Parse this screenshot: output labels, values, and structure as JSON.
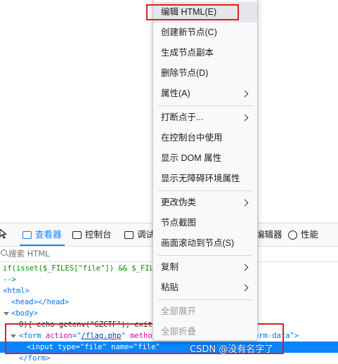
{
  "devtools": {
    "tabs": [
      {
        "label": "查看器",
        "selected": true
      },
      {
        "label": "控制台",
        "selected": false
      },
      {
        "label": "调试",
        "selected": false
      },
      {
        "label": "编辑器",
        "selected": false
      },
      {
        "label": "性能",
        "selected": false
      }
    ],
    "search_placeholder": "搜索 HTML",
    "code": {
      "php_line": "if(isset($_FILES[\"file\"]) && $_FILES",
      "comment_end": "-->",
      "html_open": "<html>",
      "head": "<head></head>",
      "body_open": "<body>",
      "text_echo": "0){ echo getenv(\"GZCTF",
      "text_echo_tail": "\"); exit;",
      "form_open": "<form",
      "form_action_attr": "action",
      "form_action_val": "/flag.php",
      "form_method_attr": "method",
      "form_tail": "c/form-data\">",
      "input_tag": "<input",
      "input_type_attr": "type",
      "input_type_val": "\"file\"",
      "input_name_attr": "name",
      "input_name_val": "\"file\"",
      "form_close": "</form>"
    }
  },
  "context_menu": {
    "items": [
      {
        "label": "编辑 HTML(E)",
        "submenu": false,
        "disabled": false,
        "active": true
      },
      {
        "label": "创建新节点(C)",
        "submenu": false,
        "disabled": false
      },
      {
        "label": "生成节点副本",
        "submenu": false,
        "disabled": false
      },
      {
        "label": "删除节点(D)",
        "submenu": false,
        "disabled": false
      },
      {
        "label": "属性(A)",
        "submenu": true,
        "disabled": false
      },
      {
        "label": "打断点于...",
        "submenu": true,
        "disabled": false
      },
      {
        "label": "在控制台中使用",
        "submenu": false,
        "disabled": false
      },
      {
        "label": "显示 DOM 属性",
        "submenu": false,
        "disabled": false
      },
      {
        "label": "显示无障碍环境属性",
        "submenu": false,
        "disabled": false
      },
      {
        "label": "更改伪类",
        "submenu": true,
        "disabled": false
      },
      {
        "label": "节点截图",
        "submenu": false,
        "disabled": false
      },
      {
        "label": "画面滚动到节点(S)",
        "submenu": false,
        "disabled": false
      },
      {
        "label": "复制",
        "submenu": true,
        "disabled": false
      },
      {
        "label": "粘贴",
        "submenu": true,
        "disabled": false
      },
      {
        "label": "全部展开",
        "submenu": false,
        "disabled": true
      },
      {
        "label": "全部折叠",
        "submenu": false,
        "disabled": true
      }
    ]
  },
  "watermark": "CSDN @没有名字了",
  "colors": {
    "accent": "#0a84ff",
    "highlight_box": "#e02020",
    "selected_row": "#0a84ff"
  }
}
